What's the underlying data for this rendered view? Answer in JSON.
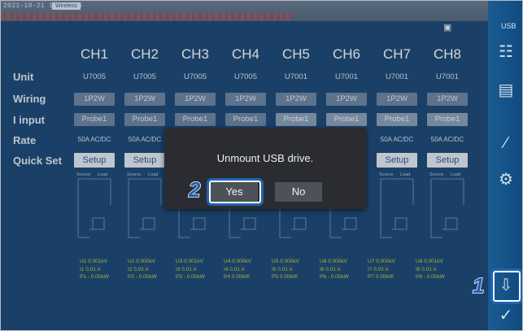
{
  "header": {
    "datetime": "2021-10-21 16:03:15",
    "status_badge": "Wireless",
    "usb_label": "USB"
  },
  "channels": [
    "CH1",
    "CH2",
    "CH3",
    "CH4",
    "CH5",
    "CH6",
    "CH7",
    "CH8"
  ],
  "rows": {
    "unit": {
      "label": "Unit",
      "values": [
        "U7005",
        "U7005",
        "U7005",
        "U7005",
        "U7001",
        "U7001",
        "U7001",
        "U7001"
      ]
    },
    "wiring": {
      "label": "Wiring",
      "values": [
        "1P2W",
        "1P2W",
        "1P2W",
        "1P2W",
        "1P2W",
        "1P2W",
        "1P2W",
        "1P2W"
      ]
    },
    "iinput": {
      "label": "I input",
      "values": [
        "Probe1",
        "Probe1",
        "Probe1",
        "Probe1",
        "Probe1",
        "Probe1",
        "Probe1",
        "Probe1"
      ]
    },
    "rate": {
      "label": "Rate",
      "values": [
        "50A AC/DC",
        "50A AC/DC",
        "",
        "",
        "",
        "",
        "50A AC/DC",
        "50A AC/DC"
      ]
    },
    "quickset": {
      "label": "Quick Set",
      "values": [
        "Setup",
        "Setup",
        "",
        "",
        "",
        "",
        "Setup",
        "Setup"
      ]
    }
  },
  "diagram_labels": {
    "source": "Source",
    "load": "Load"
  },
  "readings": {
    "line1": [
      "U1 0.001kV",
      "U2 0.000kV",
      "U3 0.001kV",
      "U4 0.000kV",
      "U5 0.000kV",
      "U6 0.000kV",
      "U7 0.000kV",
      "U8 0.001kV"
    ],
    "line2": [
      "I1 0.01 A",
      "I2 0.02 A",
      "I3 0.01 A",
      "I4 0.01 A",
      "I5 0.01 A",
      "I6 0.01 A",
      "I7 0.02 A",
      "I8 0.01 A"
    ],
    "line3": [
      "P1 - 0.00kW",
      "P2 - 0.00kW",
      "P3 - 0.00kW",
      "P4 0.00kW",
      "P5 0.00kW",
      "P6 - 0.00kW",
      "P7 0.00kW",
      "P8 - 0.00kW"
    ]
  },
  "dialog": {
    "message": "Unmount USB drive.",
    "yes_label": "Yes",
    "no_label": "No"
  },
  "callouts": {
    "step1": "1",
    "step2": "2"
  },
  "colors": {
    "background": "#1f4a78",
    "dialog": "#2a2c31",
    "callout": "#1f63b4",
    "reading": "#c9d437"
  }
}
